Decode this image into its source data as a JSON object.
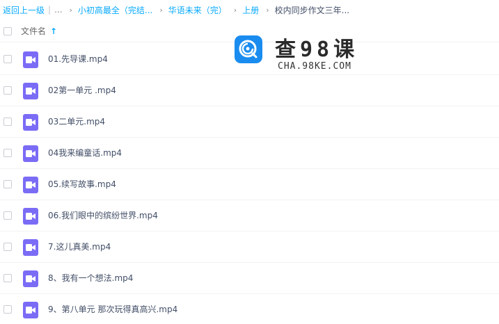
{
  "breadcrumb": {
    "back_label": "返回上一级",
    "ellipsis": "...",
    "crumbs": [
      "小初高最全（完结...",
      "华语未来（完）",
      "上册"
    ],
    "current": "校内同步作文三年..."
  },
  "header": {
    "name_label": "文件名",
    "sort_icon": "↑"
  },
  "files": [
    {
      "name": "01.先导课.mp4",
      "icon": "video-icon"
    },
    {
      "name": "02第一单元 .mp4",
      "icon": "video-icon"
    },
    {
      "name": "03二单元.mp4",
      "icon": "video-icon"
    },
    {
      "name": "04我来编童话.mp4",
      "icon": "video-icon"
    },
    {
      "name": "05.续写故事.mp4",
      "icon": "video-icon"
    },
    {
      "name": "06.我们眼中的缤纷世界.mp4",
      "icon": "video-icon"
    },
    {
      "name": "7.这儿真美.mp4",
      "icon": "video-icon"
    },
    {
      "name": "8、我有一个想法.mp4",
      "icon": "video-icon"
    },
    {
      "name": "9、第八单元 那次玩得真高兴.mp4",
      "icon": "video-icon"
    }
  ],
  "watermark": {
    "title": "查98课",
    "subtitle": "CHA.98KE.COM"
  },
  "colors": {
    "link": "#09aaff",
    "video_icon": "#7b6cf6",
    "text": "#424e67",
    "logo": "#1a8cf0"
  }
}
